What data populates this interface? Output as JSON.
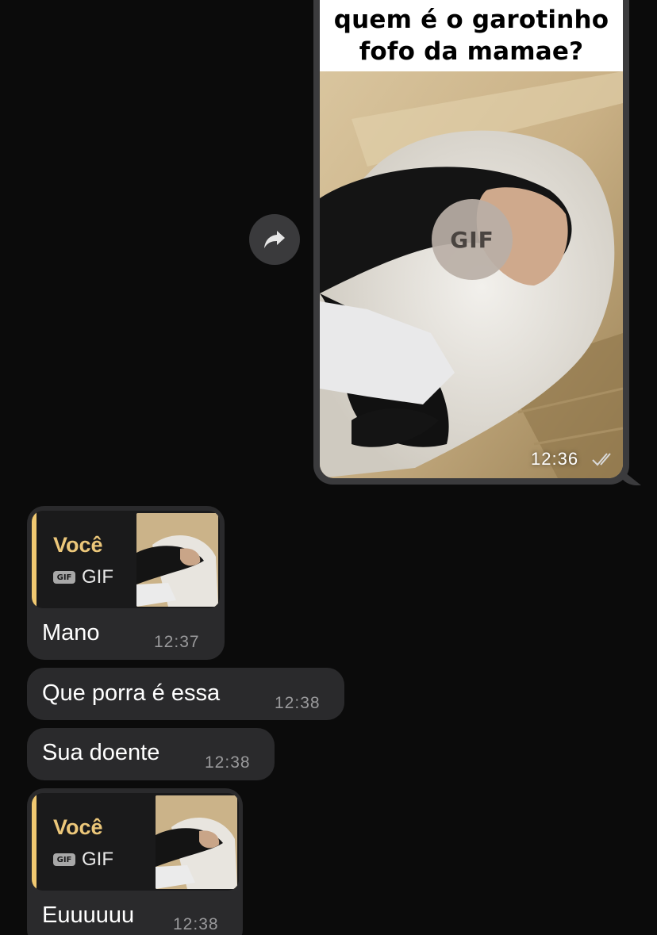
{
  "outgoing": {
    "meme_caption": "quem é o garotinho fofo da mamae?",
    "gif_badge": "GIF",
    "time": "12:36",
    "status_icon": "double-check-icon"
  },
  "forward_icon": "forward-arrow-icon",
  "incoming": [
    {
      "type": "reply",
      "reply_author": "Você",
      "reply_chip": "GIF",
      "reply_label": "GIF",
      "text": "Mano",
      "time": "12:37"
    },
    {
      "type": "text",
      "text": "Que porra é essa",
      "time": "12:38"
    },
    {
      "type": "text",
      "text": "Sua doente",
      "time": "12:38"
    },
    {
      "type": "reply",
      "reply_author": "Você",
      "reply_chip": "GIF",
      "reply_label": "GIF",
      "text": "Euuuuuu",
      "time": "12:38"
    }
  ],
  "colors": {
    "background": "#0b0b0b",
    "outgoing_bubble": "#3b3b3d",
    "incoming_bubble": "#2a2a2c",
    "reply_accent": "#f1c971",
    "reply_author": "#ecc77a",
    "time_text": "#9a9a9c"
  }
}
